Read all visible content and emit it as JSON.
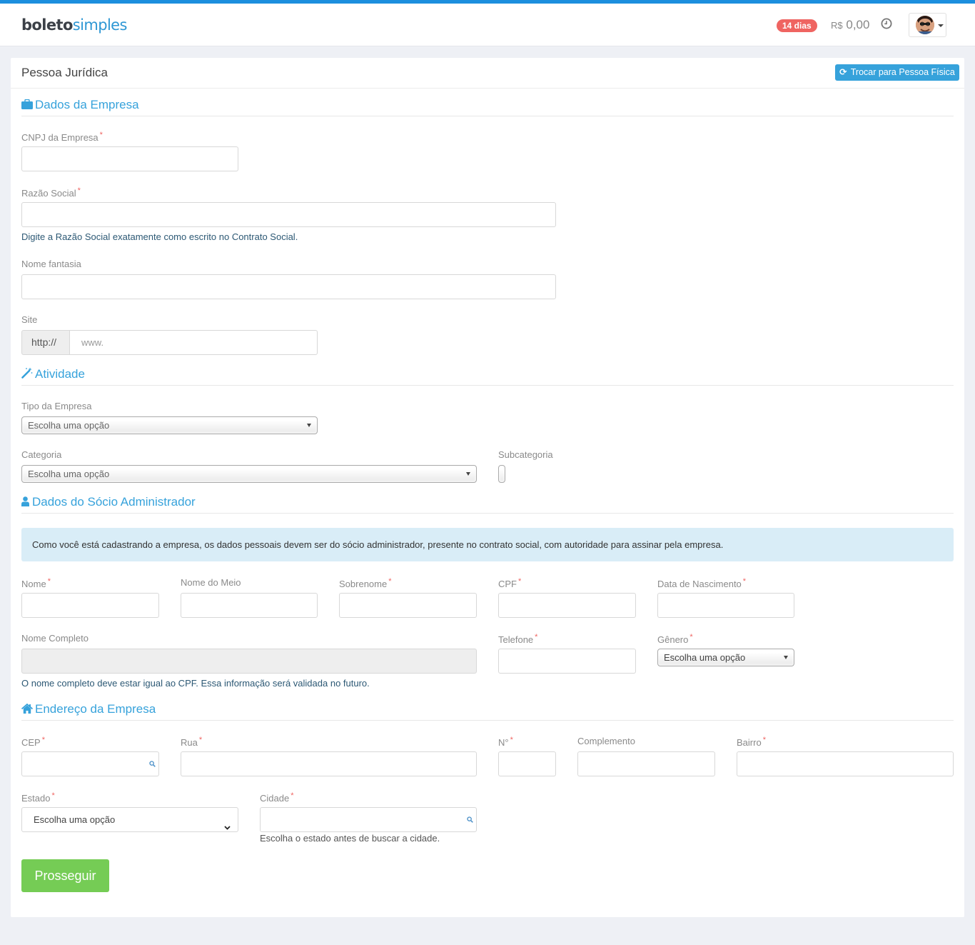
{
  "header": {
    "logo_part1": "boleto",
    "logo_part2": "simples",
    "trial_badge": "14 dias",
    "balance_currency": "R$",
    "balance_value": "0,00",
    "history_icon": "clock-icon",
    "user_menu_icon": "avatar"
  },
  "colors": {
    "accent": "#36a2db",
    "badge": "#ef6461",
    "success": "#75cc55",
    "info_bg": "#d9edf7"
  },
  "panel": {
    "title": "Pessoa Jurídica",
    "switch_icon": "refresh-icon",
    "switch_label": "Trocar para Pessoa Física"
  },
  "company": {
    "section_icon": "briefcase-icon",
    "section_title": "Dados da Empresa",
    "cnpj_label": "CNPJ da Empresa",
    "cnpj_value": "",
    "razao_label": "Razão Social",
    "razao_value": "",
    "razao_help": "Digite a Razão Social exatamente como escrito no Contrato Social.",
    "fantasia_label": "Nome fantasia",
    "fantasia_value": "",
    "site_label": "Site",
    "site_prefix": "http://",
    "site_placeholder": "www."
  },
  "activity": {
    "section_icon": "magic-wand-icon",
    "section_title": "Atividade",
    "tipo_label": "Tipo da Empresa",
    "tipo_selected": "Escolha uma opção",
    "categoria_label": "Categoria",
    "categoria_selected": "Escolha uma opção",
    "subcategoria_label": "Subcategoria"
  },
  "partner": {
    "section_icon": "user-icon",
    "section_title": "Dados do Sócio Administrador",
    "notice": "Como você está cadastrando a empresa, os dados pessoais devem ser do sócio administrador, presente no contrato social, com autoridade para assinar pela empresa.",
    "nome_label": "Nome",
    "nome_meio_label": "Nome do Meio",
    "sobrenome_label": "Sobrenome",
    "cpf_label": "CPF",
    "nascimento_label": "Data de Nascimento",
    "nome_completo_label": "Nome Completo",
    "nome_completo_help": "O nome completo deve estar igual ao CPF. Essa informação será validada no futuro.",
    "telefone_label": "Telefone",
    "genero_label": "Gênero",
    "genero_selected": "Escolha uma opção"
  },
  "address": {
    "section_icon": "home-icon",
    "section_title": "Endereço da Empresa",
    "cep_label": "CEP",
    "rua_label": "Rua",
    "numero_label": "N°",
    "complemento_label": "Complemento",
    "bairro_label": "Bairro",
    "estado_label": "Estado",
    "estado_selected": "Escolha uma opção",
    "cidade_label": "Cidade",
    "cidade_help": "Escolha o estado antes de buscar a cidade."
  },
  "actions": {
    "submit_label": "Prosseguir"
  }
}
